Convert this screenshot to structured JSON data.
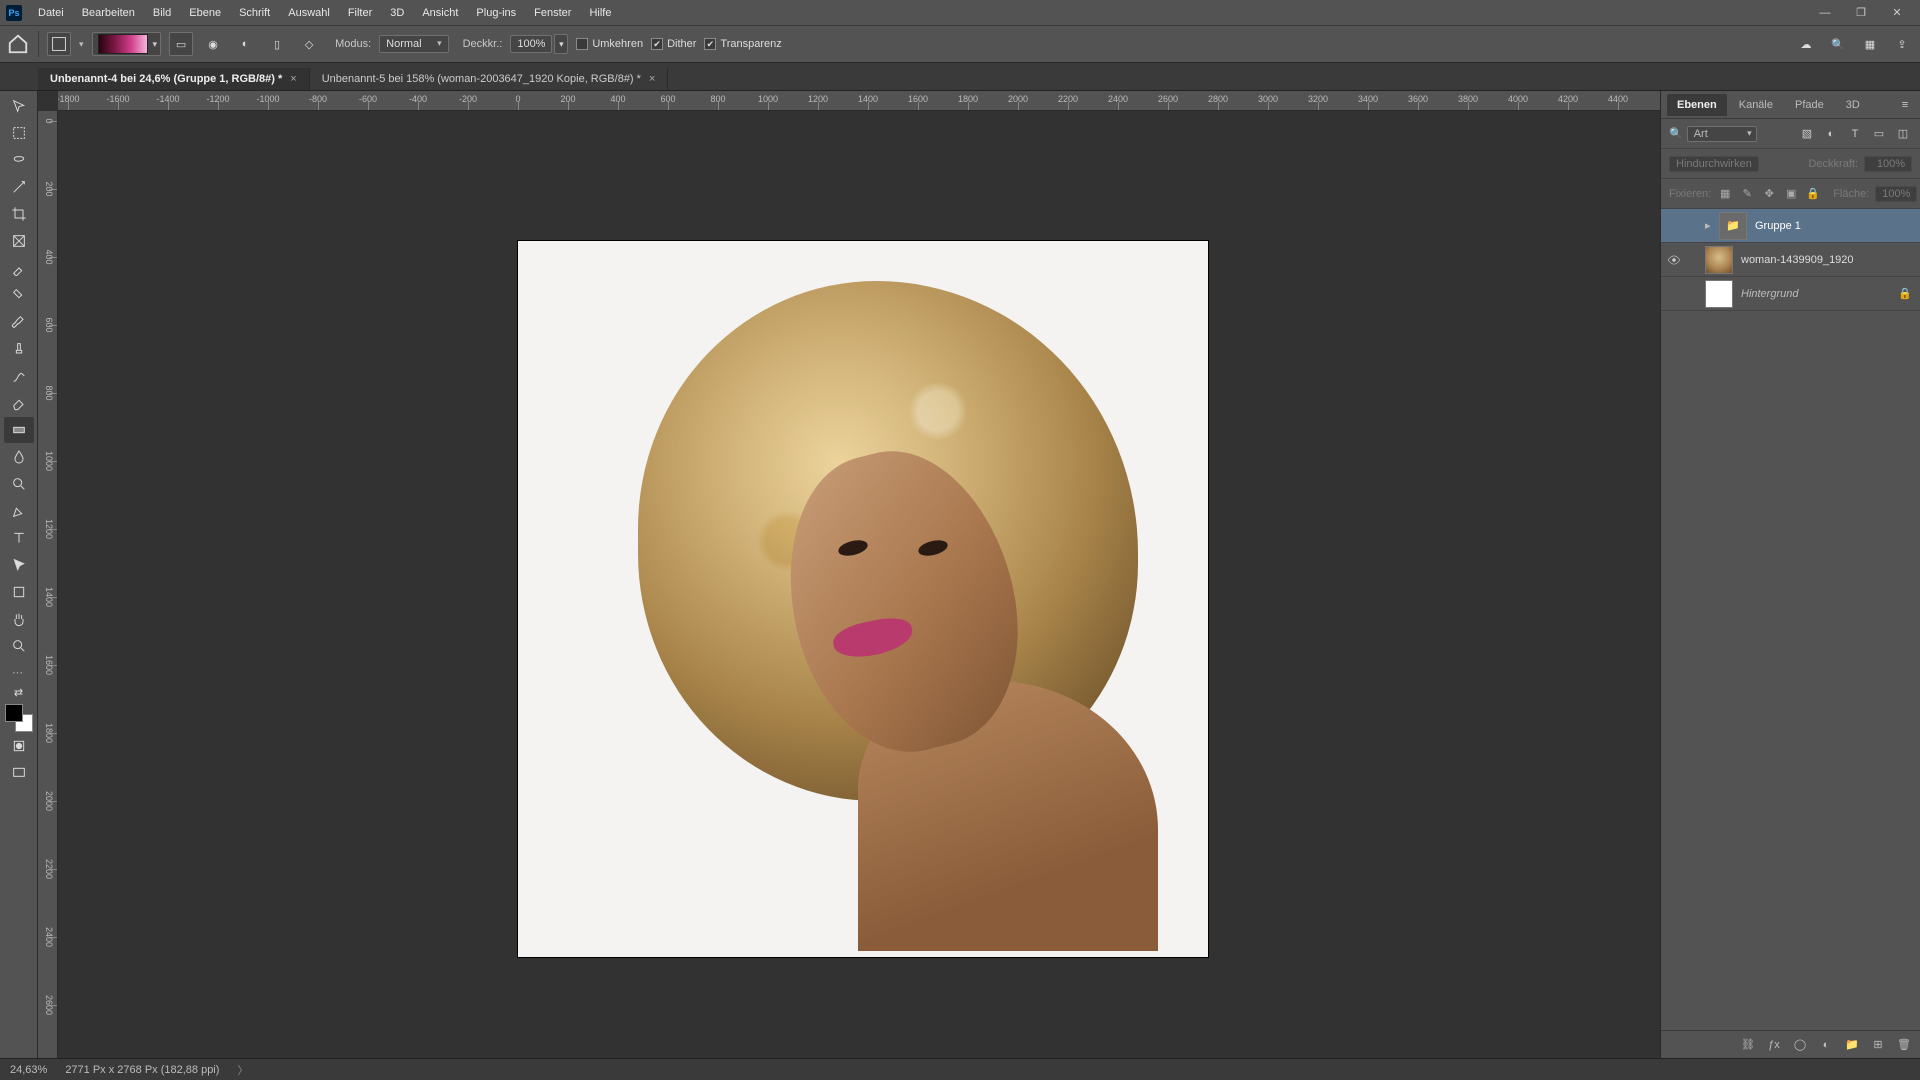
{
  "menu": [
    "Datei",
    "Bearbeiten",
    "Bild",
    "Ebene",
    "Schrift",
    "Auswahl",
    "Filter",
    "3D",
    "Ansicht",
    "Plug-ins",
    "Fenster",
    "Hilfe"
  ],
  "optbar": {
    "modus_label": "Modus:",
    "modus_value": "Normal",
    "opacity_label": "Deckkr.:",
    "opacity_value": "100%",
    "chk_umkehren": "Umkehren",
    "chk_dither": "Dither",
    "chk_transp": "Transparenz"
  },
  "tabs": [
    {
      "title": "Unbenannt-4 bei 24,6% (Gruppe 1, RGB/8#) *",
      "active": true
    },
    {
      "title": "Unbenannt-5 bei 158% (woman-2003647_1920 Kopie, RGB/8#) *",
      "active": false
    }
  ],
  "ruler_h": [
    "-1800",
    "-1600",
    "-1400",
    "-1200",
    "-1000",
    "-800",
    "-600",
    "-400",
    "-200",
    "0",
    "200",
    "400",
    "600",
    "800",
    "1000",
    "1200",
    "1400",
    "1600",
    "1800",
    "2000",
    "2200",
    "2400",
    "2600",
    "2800",
    "3000",
    "3200",
    "3400",
    "3600",
    "3800",
    "4000",
    "4200",
    "4400"
  ],
  "ruler_v": [
    "0",
    "200",
    "400",
    "600",
    "800",
    "1000",
    "1200",
    "1400",
    "1600",
    "1800",
    "2000",
    "2200",
    "2400",
    "2600"
  ],
  "panels": {
    "tabs": [
      "Ebenen",
      "Kanäle",
      "Pfade",
      "3D"
    ],
    "search_label": "Art",
    "blend_label": "Hindurchwirken",
    "opacity_label": "Deckkraft:",
    "opacity_value": "100%",
    "fix_label": "Fixieren:",
    "fill_label": "Fläche:",
    "fill_value": "100%"
  },
  "layers": [
    {
      "type": "group",
      "name": "Gruppe 1",
      "visible": false,
      "selected": true,
      "expanded": false
    },
    {
      "type": "smart",
      "name": "woman-1439909_1920",
      "visible": true,
      "selected": false
    },
    {
      "type": "bg",
      "name": "Hintergrund",
      "visible": false,
      "selected": false,
      "locked": true
    }
  ],
  "status": {
    "zoom": "24,63%",
    "dims": "2771 Px x 2768 Px (182,88 ppi)"
  }
}
